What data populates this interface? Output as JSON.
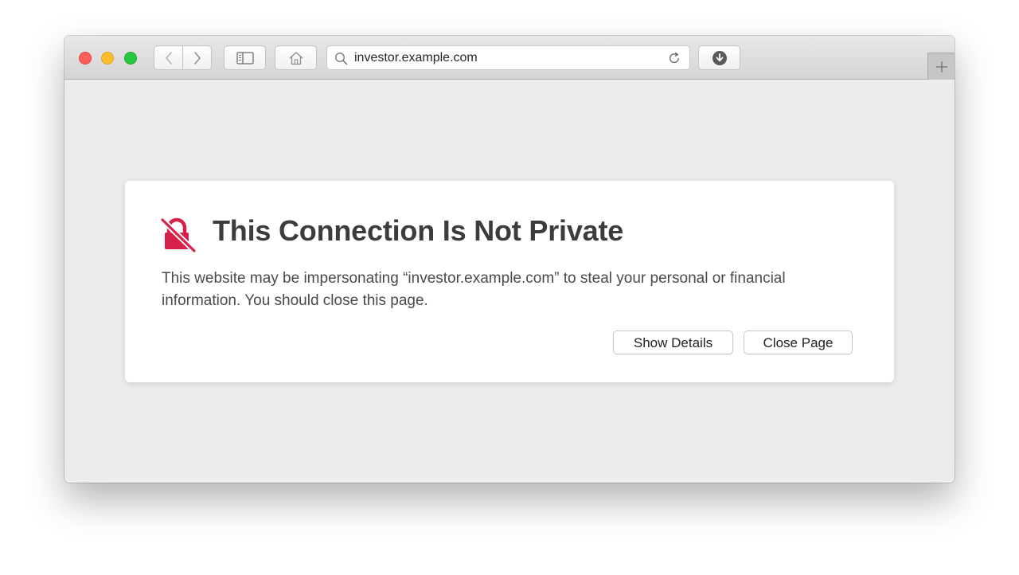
{
  "toolbar": {
    "address_url": "investor.example.com"
  },
  "icons": {
    "window_close": "close-dot",
    "window_minimize": "minimize-dot",
    "window_zoom": "zoom-dot",
    "back": "chevron-left-icon",
    "forward": "chevron-right-icon",
    "sidebar": "sidebar-icon",
    "home": "home-icon",
    "search": "search-icon",
    "reload": "reload-icon",
    "downloads": "download-icon",
    "new_tab": "plus-icon",
    "warning": "broken-lock-icon"
  },
  "colors": {
    "warning_icon": "#d6214b",
    "light_red": "#fc5f57",
    "light_yellow": "#fdbc2e",
    "light_green": "#28c840"
  },
  "warning": {
    "title": "This Connection Is Not Private",
    "message": "This website may be impersonating “investor.example.com” to steal your personal or financial information. You should close this page.",
    "show_details_label": "Show Details",
    "close_page_label": "Close Page"
  }
}
